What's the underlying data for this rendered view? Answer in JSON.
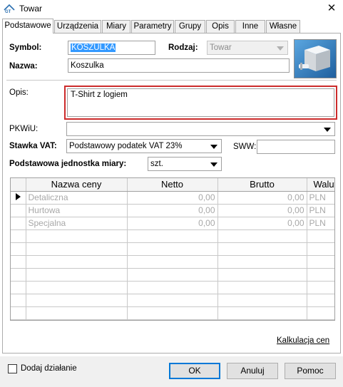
{
  "window": {
    "title": "Towar",
    "close_glyph": "✕"
  },
  "tabs": [
    {
      "label": "Podstawowe"
    },
    {
      "label": "Urządzenia"
    },
    {
      "label": "Miary"
    },
    {
      "label": "Parametry"
    },
    {
      "label": "Grupy"
    },
    {
      "label": "Opis"
    },
    {
      "label": "Inne"
    },
    {
      "label": "Własne"
    }
  ],
  "form": {
    "symbol_label": "Symbol:",
    "symbol_value": "KOSZULKA",
    "rodzaj_label": "Rodzaj:",
    "rodzaj_value": "Towar",
    "nazwa_label": "Nazwa:",
    "nazwa_value": "Koszulka",
    "opis_label": "Opis:",
    "opis_value": "T-Shirt z logiem",
    "pkwiu_label": "PKWiU:",
    "pkwiu_value": "",
    "vat_label": "Stawka VAT:",
    "vat_value": "Podstawowy podatek VAT 23%",
    "sww_label": "SWW:",
    "sww_value": "",
    "unit_label": "Podstawowa jednostka miary:",
    "unit_value": "szt."
  },
  "prices": {
    "headers": [
      "Nazwa ceny",
      "Netto",
      "Brutto",
      "Waluta"
    ],
    "rows": [
      {
        "name": "Detaliczna",
        "netto": "0,00",
        "brutto": "0,00",
        "currency": "PLN"
      },
      {
        "name": "Hurtowa",
        "netto": "0,00",
        "brutto": "0,00",
        "currency": "PLN"
      },
      {
        "name": "Specjalna",
        "netto": "0,00",
        "brutto": "0,00",
        "currency": "PLN"
      }
    ]
  },
  "link_kalkulacja": "Kalkulacja cen",
  "footer": {
    "checkbox_label": "Dodaj działanie",
    "ok_label": "OK",
    "cancel_label": "Anuluj",
    "help_label": "Pomoc"
  },
  "icons": {
    "app": "app-logo-icon",
    "product": "product-box-icon"
  },
  "colors": {
    "highlight_border": "#cc2b2b",
    "selection": "#3399ff",
    "default_button_border": "#0078d7"
  }
}
